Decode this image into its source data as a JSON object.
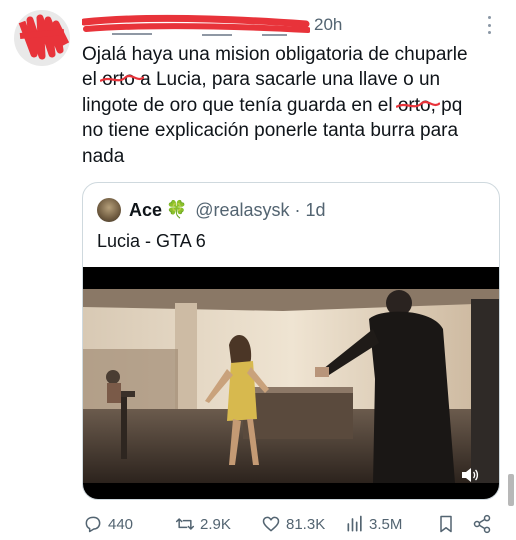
{
  "post": {
    "time": "20h",
    "text_lines": [
      "Ojalá haya una mision obligatoria de chuparle",
      [
        "el ",
        "orto",
        " a Lucia, para sacarle una llave o un"
      ],
      [
        "lingote de oro  que tenía guarda  en el ",
        "orto",
        ", pq"
      ],
      "no tiene explicación ponerle tanta burra para",
      "nada"
    ]
  },
  "quote": {
    "name": "Ace",
    "emoji": "🍀",
    "handle": "@realasysk",
    "separator": " · ",
    "time": "1d",
    "text": "Lucia - GTA 6"
  },
  "actions": {
    "replies": "440",
    "reposts": "2.9K",
    "likes": "81.3K",
    "views": "3.5M"
  },
  "icons": {
    "more": "more-vertical-icon",
    "reply": "reply-icon",
    "repost": "repost-icon",
    "like": "heart-icon",
    "views": "views-chart-icon",
    "bookmark": "bookmark-icon",
    "share": "share-icon",
    "volume": "volume-icon"
  },
  "colors": {
    "text": "#0f1419",
    "secondary": "#536471",
    "redaction": "#e8333a",
    "border": "#cfd9de"
  }
}
